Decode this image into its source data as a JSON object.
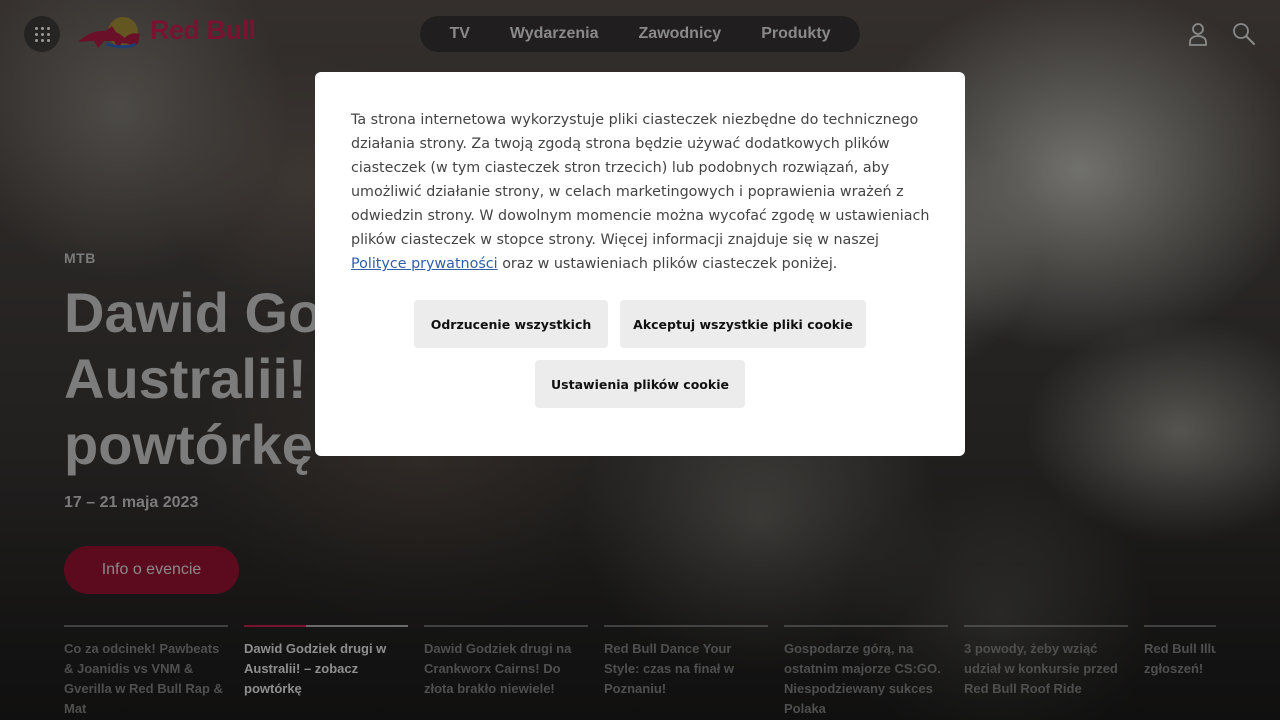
{
  "brand": {
    "name": "Red Bull",
    "color": "#7a1330"
  },
  "nav": {
    "items": [
      "TV",
      "Wydarzenia",
      "Zawodnicy",
      "Produkty"
    ]
  },
  "header": {
    "user_icon": "user-icon",
    "search_icon": "search-icon",
    "menu_icon": "grid-menu-icon"
  },
  "hero": {
    "category": "MTB",
    "title_lines": [
      "Dawid Go",
      "Australii!",
      "powtórkę"
    ],
    "date": "17 – 21 maja 2023",
    "button": "Info o evencie"
  },
  "carousel": [
    {
      "text": "Co za odcinek! Pawbeats & Joanidis vs VNM & Gverilla w Red Bull Rap & Mat",
      "active": false,
      "progress": 0
    },
    {
      "text": "Dawid Godziek drugi w Australii! – zobacz powtórkę",
      "active": true,
      "progress": 0.38
    },
    {
      "text": "Dawid Godziek drugi na Crankworx Cairns! Do złota brakło niewiele!",
      "active": false,
      "progress": 0
    },
    {
      "text": "Red Bull Dance Your Style: czas na finał w Poznaniu!",
      "active": false,
      "progress": 0
    },
    {
      "text": "Gospodarze górą, na ostatnim majorze CS:GO. Niespodziewany sukces Polaka",
      "active": false,
      "progress": 0
    },
    {
      "text": "3 powody, żeby wziąć udział w konkursie przed Red Bull Roof Ride",
      "active": false,
      "progress": 0
    },
    {
      "text": "Red Bull Illu przegap ter zgłoszeń!",
      "active": false,
      "progress": 0
    }
  ],
  "cookie": {
    "text_before_link": "Ta strona internetowa wykorzystuje pliki ciasteczek niezbędne do technicznego działania strony. Za twoją zgodą strona będzie używać dodatkowych plików ciasteczek (w tym ciasteczek stron trzecich) lub podobnych rozwiązań, aby umożliwić działanie strony, w celach marketingowych i poprawienia wrażeń z odwiedzin strony. W dowolnym momencie można wycofać zgodę w ustawieniach plików ciasteczek w stopce strony. Więcej informacji znajduje się w naszej",
    "link_text": "Polityce prywatności",
    "text_after_link": "oraz w ustawieniach plików ciasteczek poniżej.",
    "reject_all": "Odrzucenie wszystkich",
    "accept_all": "Akceptuj wszystkie pliki cookie",
    "settings": "Ustawienia plików cookie"
  }
}
